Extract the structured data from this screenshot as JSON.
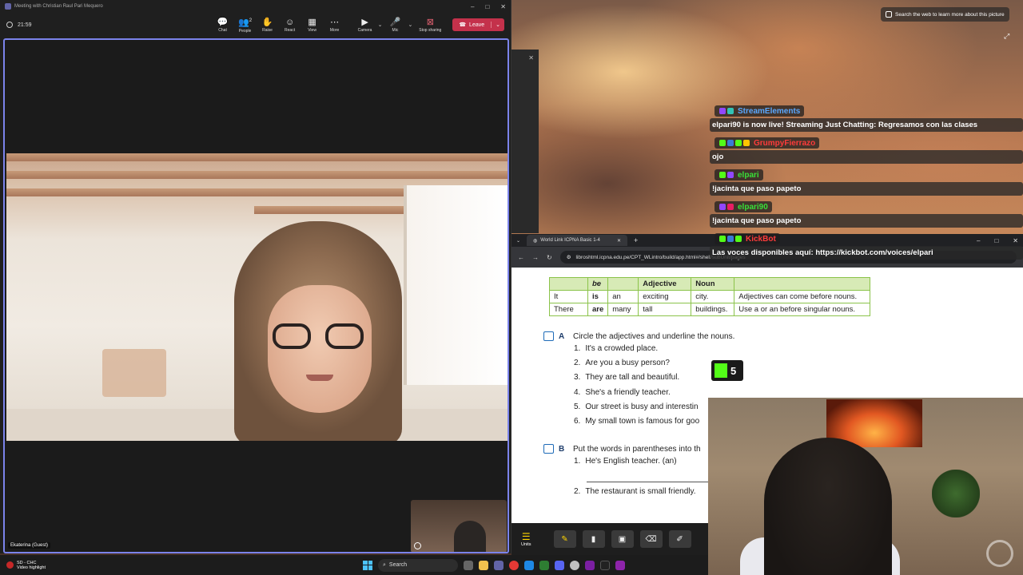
{
  "teams": {
    "window_title": "Meeting with Christian Raul Pari Mequero",
    "timer": "21:59",
    "tools": [
      {
        "label": "Chat",
        "icon": "chat-icon"
      },
      {
        "label": "People",
        "icon": "people-icon",
        "count": "2"
      },
      {
        "label": "Raise",
        "icon": "raise-hand-icon"
      },
      {
        "label": "React",
        "icon": "react-icon"
      },
      {
        "label": "View",
        "icon": "view-icon"
      },
      {
        "label": "More",
        "icon": "more-icon"
      }
    ],
    "camera_label": "Camera",
    "mic_label": "Mic",
    "stop_sharing_label": "Stop sharing",
    "leave_label": "Leave",
    "participant_name": "Ekaterina (Guest)",
    "accent_color": "#7b83eb",
    "leave_color": "#c4314b"
  },
  "web_chip": {
    "label": "Search the web to learn more about this picture"
  },
  "chat": {
    "messages": [
      {
        "user": "StreamElements",
        "color": "#5aa8ff",
        "text": "elpari90 is now live! Streaming Just Chatting: Regresamos con las clases"
      },
      {
        "user": "GrumpyFierrazo",
        "color": "#ff3b3b",
        "text": "ojo"
      },
      {
        "user": "elpari",
        "color": "#38e038",
        "text": "!jacinta que paso papeto"
      },
      {
        "user": "elpari90",
        "color": "#38e038",
        "text": "!jacinta que paso papeto"
      },
      {
        "user": "KickBot",
        "color": "#ff3b3b",
        "text": "Las voces disponibles aquí: https://kickbot.com/voices/elpari"
      }
    ]
  },
  "kickbot_counter": "5",
  "browser": {
    "tab_title": "World Link ICPNA Basic 1-4",
    "url": "libroshtml.icpna.edu.pe/CPT_WLintro/build/app.html#/shell/subUnit/pages"
  },
  "grammar_table": {
    "headers": [
      "",
      "be",
      "",
      "Adjective",
      "Noun",
      ""
    ],
    "rows": [
      [
        "It",
        "is",
        "an",
        "exciting",
        "city.",
        "Adjectives can come before nouns."
      ],
      [
        "There",
        "are",
        "many",
        "tall",
        "buildings.",
        "Use a or an before singular nouns."
      ]
    ]
  },
  "exercise_a": {
    "letter": "A",
    "instruction": "Circle the adjectives and underline the nouns.",
    "items": [
      {
        "n": "1.",
        "text": "It's a crowded place."
      },
      {
        "n": "2.",
        "text": "Are you a busy person?"
      },
      {
        "n": "3.",
        "text": "They are tall and beautiful."
      },
      {
        "n": "4.",
        "text": "She's a friendly teacher."
      },
      {
        "n": "5.",
        "text": "Our street is busy and interestin"
      },
      {
        "n": "6.",
        "text": "My small town is famous for goo"
      }
    ]
  },
  "exercise_b": {
    "letter": "B",
    "instruction": "Put the words in parentheses into th",
    "items": [
      {
        "n": "1.",
        "text": "He's English teacher. (an)"
      },
      {
        "n": "2.",
        "text": "The restaurant is small friendly."
      }
    ]
  },
  "book_toolbar": {
    "units_label": "Units"
  },
  "taskbar": {
    "widget_title": "SD - CHC",
    "widget_subtitle": "Video highlight",
    "search_placeholder": "Search"
  }
}
